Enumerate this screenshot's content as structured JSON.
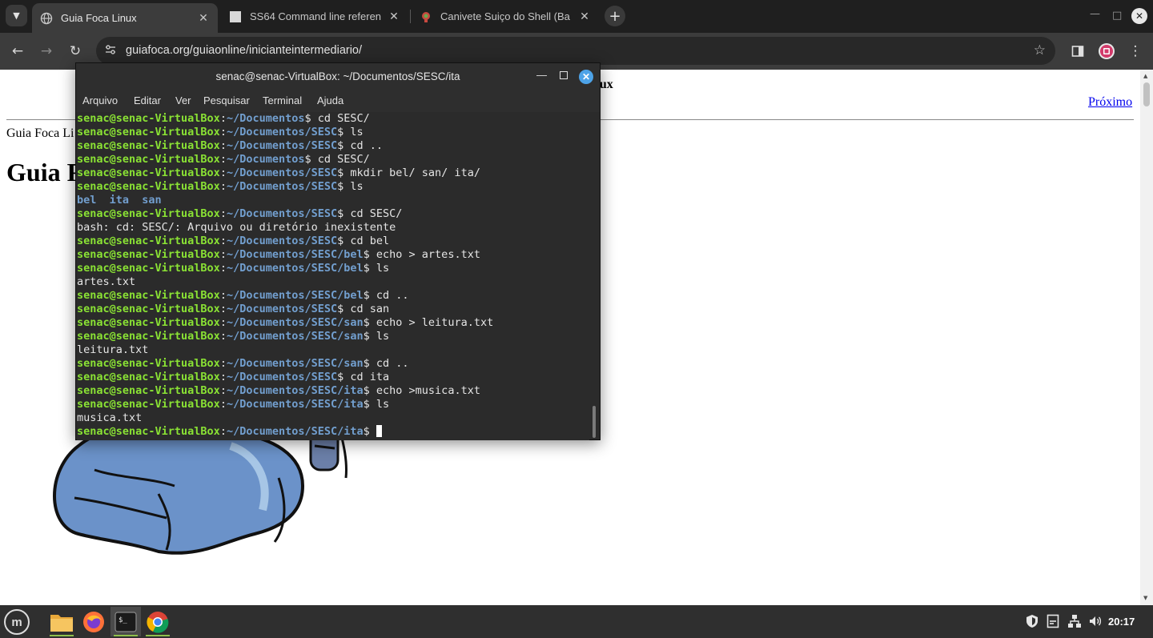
{
  "browser": {
    "tabs": [
      {
        "title": "Guia Foca Linux",
        "active": true
      },
      {
        "title": "SS64 Command line referen",
        "active": false
      },
      {
        "title": "Canivete Suiço do Shell (Ba",
        "active": false
      }
    ],
    "url": "guiafoca.org/guiaonline/inicianteintermediario/"
  },
  "webpage": {
    "header_title": "nux",
    "next_link": "Próximo",
    "breadcrumb": "Guia Foca Li",
    "heading": "Guia F"
  },
  "terminal": {
    "title": "senac@senac-VirtualBox: ~/Documentos/SESC/ita",
    "menu": [
      "Arquivo",
      "Editar",
      "Ver",
      "Pesquisar",
      "Terminal",
      "Ajuda"
    ],
    "prompt_user": "senac@senac-VirtualBox",
    "lines": [
      {
        "type": "prompt",
        "path": "~/Documentos",
        "cmd": " cd SESC/"
      },
      {
        "type": "prompt",
        "path": "~/Documentos/SESC",
        "cmd": " ls"
      },
      {
        "type": "prompt",
        "path": "~/Documentos/SESC",
        "cmd": " cd .."
      },
      {
        "type": "prompt",
        "path": "~/Documentos",
        "cmd": " cd SESC/"
      },
      {
        "type": "prompt",
        "path": "~/Documentos/SESC",
        "cmd": " mkdir bel/ san/ ita/"
      },
      {
        "type": "prompt",
        "path": "~/Documentos/SESC",
        "cmd": " ls"
      },
      {
        "type": "dirs",
        "text": "bel  ita  san"
      },
      {
        "type": "prompt",
        "path": "~/Documentos/SESC",
        "cmd": " cd SESC/"
      },
      {
        "type": "output",
        "text": "bash: cd: SESC/: Arquivo ou diretório inexistente"
      },
      {
        "type": "prompt",
        "path": "~/Documentos/SESC",
        "cmd": " cd bel"
      },
      {
        "type": "prompt",
        "path": "~/Documentos/SESC/bel",
        "cmd": " echo > artes.txt"
      },
      {
        "type": "prompt",
        "path": "~/Documentos/SESC/bel",
        "cmd": " ls"
      },
      {
        "type": "output",
        "text": "artes.txt"
      },
      {
        "type": "prompt",
        "path": "~/Documentos/SESC/bel",
        "cmd": " cd .."
      },
      {
        "type": "prompt",
        "path": "~/Documentos/SESC",
        "cmd": " cd san"
      },
      {
        "type": "prompt",
        "path": "~/Documentos/SESC/san",
        "cmd": " echo > leitura.txt"
      },
      {
        "type": "prompt",
        "path": "~/Documentos/SESC/san",
        "cmd": " ls"
      },
      {
        "type": "output",
        "text": "leitura.txt"
      },
      {
        "type": "prompt",
        "path": "~/Documentos/SESC/san",
        "cmd": " cd .."
      },
      {
        "type": "prompt",
        "path": "~/Documentos/SESC",
        "cmd": " cd ita"
      },
      {
        "type": "prompt",
        "path": "~/Documentos/SESC/ita",
        "cmd": " echo >musica.txt"
      },
      {
        "type": "prompt",
        "path": "~/Documentos/SESC/ita",
        "cmd": " ls"
      },
      {
        "type": "output",
        "text": "musica.txt"
      },
      {
        "type": "prompt",
        "path": "~/Documentos/SESC/ita",
        "cmd": " ",
        "cursor": true
      }
    ],
    "colors": {
      "user": "#8ae234",
      "path": "#729fcf",
      "background": "#2b2b2b"
    }
  },
  "taskbar": {
    "apps": [
      "files-icon",
      "firefox-icon",
      "terminal-icon",
      "chrome-icon"
    ],
    "clock": "20:17"
  }
}
